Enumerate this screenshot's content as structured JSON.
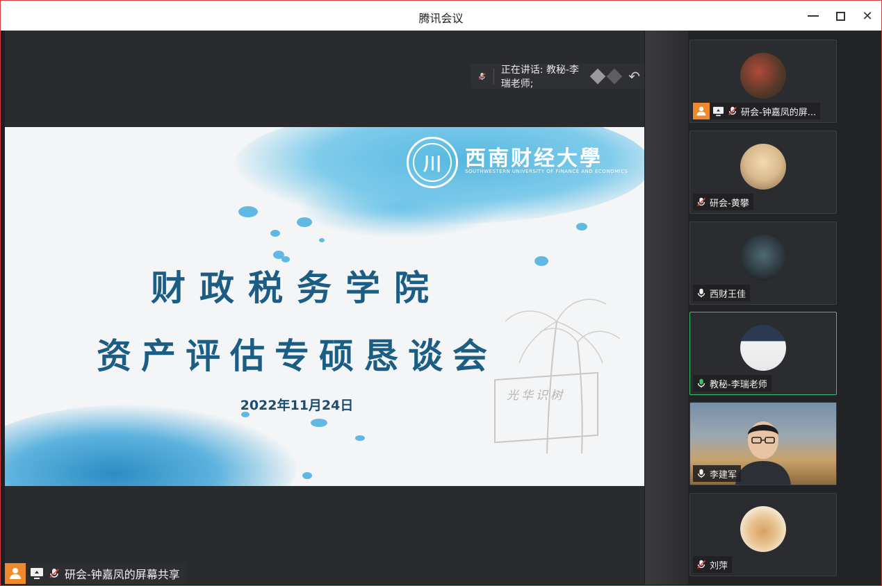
{
  "window": {
    "title": "腾讯会议",
    "minimize_label": "",
    "maximize_label": "",
    "close_label": "✕"
  },
  "speaker": {
    "label": "正在讲话: 教秘-李瑞老师;"
  },
  "slide": {
    "university_name": "西南财经大學",
    "university_name_en": "SOUTHWESTERN UNIVERSITY OF FINANCE AND ECONOMICS",
    "logo_glyph": "川",
    "title_line1": "财政税务学院",
    "title_line2": "资产评估专硕恳谈会",
    "date": "2022年11月24日",
    "stone_text": "光华识树"
  },
  "share": {
    "label": "研会-钟嘉凤的屏幕共享"
  },
  "participants": [
    {
      "name": "研会-钟嘉凤的屏...",
      "mic": "muted",
      "sharing": true,
      "active": false,
      "avatar_color": "#5a3a2a"
    },
    {
      "name": "研会-黄攀",
      "mic": "muted",
      "sharing": false,
      "active": false,
      "avatar_color": "#d8b98c"
    },
    {
      "name": "西财王佳",
      "mic": "on",
      "sharing": false,
      "active": false,
      "avatar_color": "#2f3a40"
    },
    {
      "name": "教秘-李瑞老师",
      "mic": "speaking",
      "sharing": false,
      "active": true,
      "avatar_color": "#e8e8e8"
    },
    {
      "name": "李建军",
      "mic": "on",
      "sharing": false,
      "active": false,
      "avatar_color": "#7790a8"
    },
    {
      "name": "刘萍",
      "mic": "muted",
      "sharing": false,
      "active": false,
      "avatar_color": "#f2e6cf"
    }
  ],
  "colors": {
    "accent_orange": "#ee8a2d",
    "speaking_green": "#3ec06a",
    "slide_title_blue": "#1c5d84"
  }
}
